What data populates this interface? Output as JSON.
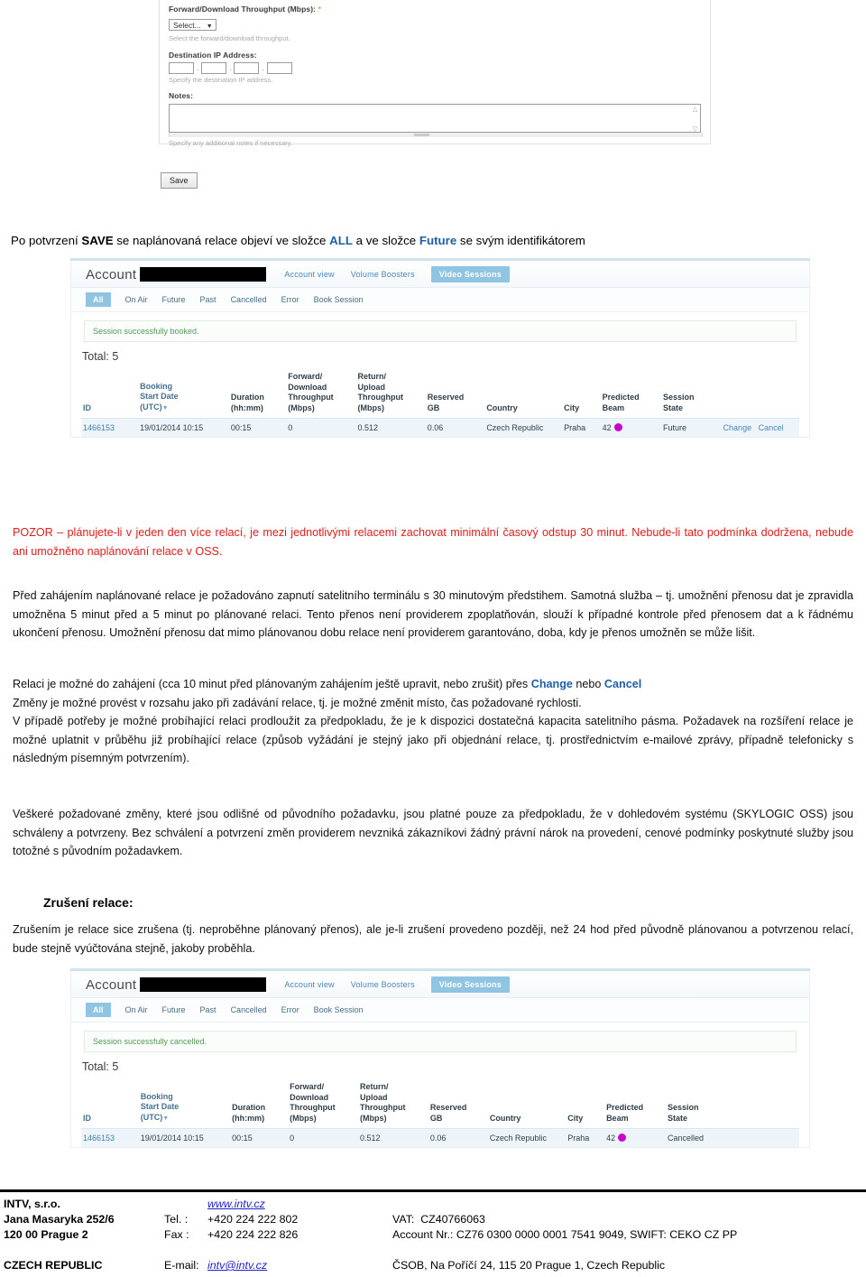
{
  "form": {
    "throughput_label": "Forward/Download Throughput (Mbps):",
    "required_mark": "*",
    "throughput_value": "Select...",
    "throughput_hint": "Select the forward/download throughput.",
    "dest_ip_label": "Destination IP Address:",
    "dest_ip_octets": [
      "",
      "",
      "",
      ""
    ],
    "dest_ip_hint": "Specify the destination IP address.",
    "notes_label": "Notes:",
    "notes_value": "",
    "notes_hint": "Specify any additional notes if necessary.",
    "save_label": "Save"
  },
  "caption": {
    "p1": "Po potvrzení ",
    "save": "SAVE",
    "p2": " se naplánovaná relace objeví ve složce ",
    "all": "ALL",
    "p3": " a ve složce ",
    "future": "Future",
    "p4": " se svým identifikátorem"
  },
  "screenshot_booked": {
    "account_label": "Account",
    "topnav": [
      {
        "label": "Account view",
        "selected": false
      },
      {
        "label": "Volume Boosters",
        "selected": false
      },
      {
        "label": "Video Sessions",
        "selected": true
      }
    ],
    "subnav": [
      {
        "label": "All",
        "selected": true
      },
      {
        "label": "On Air",
        "selected": false
      },
      {
        "label": "Future",
        "selected": false
      },
      {
        "label": "Past",
        "selected": false
      },
      {
        "label": "Cancelled",
        "selected": false
      },
      {
        "label": "Error",
        "selected": false
      },
      {
        "label": "Book Session",
        "selected": false
      }
    ],
    "flash": "Session successfully booked.",
    "total": "Total: 5",
    "columns": [
      "ID",
      "Booking\nStart Date\n(UTC)",
      "Duration\n(hh:mm)",
      "Forward/\nDownload\nThroughput\n(Mbps)",
      "Return/\nUpload\nThroughput\n(Mbps)",
      "Reserved\nGB",
      "Country",
      "City",
      "Predicted\nBeam",
      "Session\nState"
    ],
    "row": {
      "id": "1466153",
      "start_date": "19/01/2014 10:15",
      "duration": "00:15",
      "forward": "0",
      "return": "0.512",
      "reserved_gb": "0.06",
      "country": "Czech Republic",
      "city": "Praha",
      "beam": "42",
      "state": "Future",
      "action_change": "Change",
      "action_cancel": "Cancel"
    }
  },
  "screenshot_cancelled": {
    "account_label": "Account",
    "topnav": [
      {
        "label": "Account view",
        "selected": false
      },
      {
        "label": "Volume Boosters",
        "selected": false
      },
      {
        "label": "Video Sessions",
        "selected": true
      }
    ],
    "subnav": [
      {
        "label": "All",
        "selected": true
      },
      {
        "label": "On Air",
        "selected": false
      },
      {
        "label": "Future",
        "selected": false
      },
      {
        "label": "Past",
        "selected": false
      },
      {
        "label": "Cancelled",
        "selected": false
      },
      {
        "label": "Error",
        "selected": false
      },
      {
        "label": "Book Session",
        "selected": false
      }
    ],
    "flash": "Session successfully cancelled.",
    "total": "Total: 5",
    "columns": [
      "ID",
      "Booking\nStart Date\n(UTC)",
      "Duration\n(hh:mm)",
      "Forward/\nDownload\nThroughput\n(Mbps)",
      "Return/\nUpload\nThroughput\n(Mbps)",
      "Reserved\nGB",
      "Country",
      "City",
      "Predicted\nBeam",
      "Session\nState"
    ],
    "row": {
      "id": "1466153",
      "start_date": "19/01/2014 10:15",
      "duration": "00:15",
      "forward": "0",
      "return": "0.512",
      "reserved_gb": "0.06",
      "country": "Czech Republic",
      "city": "Praha",
      "beam": "42",
      "state": "Cancelled"
    }
  },
  "body_text": {
    "pozor": "POZOR – plánujete-li v jeden den více relací, je mezi jednotlivými relacemi zachovat minimální časový odstup 30 minut. Nebude-li tato podmínka dodržena, nebude ani umožněno naplánování relace v OSS.",
    "pred": "Před zahájením naplánované relace je požadováno zapnutí satelitního terminálu s 30 minutovým předstihem. Samotná služba – tj. umožnění přenosu dat je zpravidla umožněna 5 minut před a 5 minut po plánované relaci. Tento přenos není providerem zpoplatňován, slouží k případné kontrole před přenosem dat a k řádnému ukončení přenosu. Umožnění přenosu dat mimo plánovanou dobu relace není providerem garantováno, doba, kdy je přenos umožněn se může lišit.",
    "relaci_a": "Relaci je možné do zahájení (cca 10 minut před plánovaným zahájením ještě upravit, nebo zrušit) přes ",
    "relaci_change": "Change",
    "relaci_mid": " nebo ",
    "relaci_cancel": "Cancel",
    "relaci_b": "Změny je možné provést v rozsahu jako při zadávání relace, tj. je možné změnit místo, čas požadované rychlosti.",
    "relaci_c": "V případě potřeby je možné probíhající relaci prodloužit za předpokladu, že je k dispozici dostatečná kapacita satelitního pásma. Požadavek na rozšíření relace je možné uplatnit v průběhu již probíhající relace (způsob vyžádání je stejný jako při objednání relace, tj. prostřednictvím e-mailové zprávy, případně telefonicky s následným písemným potvrzením).",
    "veskere": "Veškeré požadované změny, které jsou odlišné od původního požadavku, jsou platné pouze za předpokladu, že v dohledovém systému (SKYLOGIC OSS) jsou schváleny a potvrzeny. Bez schválení a potvrzení změn providerem nevzniká zákazníkovi žádný právní nárok na provedení, cenové podmínky poskytnuté služby jsou totožné s původním požadavkem.",
    "zruseni_heading": "Zrušení relace:",
    "zruseni": "Zrušením je relace sice zrušena (tj. neproběhne plánovaný přenos), ale je-li zrušení provedeno později, než 24 hod před původně plánovanou a potvrzenou relací, bude stejně vyúčtována stejně, jakoby proběhla."
  },
  "footer": {
    "company": "INTV, s.r.o.",
    "street": "Jana Masaryka 252/6",
    "city": "120 00 Prague 2",
    "country": "CZECH REPUBLIC",
    "web": "www.intv.cz",
    "tel_label": "Tel. :",
    "tel_value": "+420 224 222 802",
    "fax_label": "Fax :",
    "fax_value": "+420 224 222 826",
    "email_label": "E-mail:",
    "email_value": "intv@intv.cz",
    "vat_label": "VAT:",
    "vat_value": "CZ40766063",
    "account_line": "Account Nr.: CZ76 0300 0000 0001 7541 9049, SWIFT: CEKO CZ PP",
    "bank_line": "ČSOB, Na Poříčí 24, 115 20 Prague 1, Czech Republic"
  },
  "colors": {
    "accent_blue": "#4a86b8",
    "selected_tab": "#8fc4e3",
    "warning_red": "#e01b1b",
    "link_blue": "#1f5fa8",
    "beam_dot": "#cc00cc",
    "success_green": "#4f9a57"
  }
}
